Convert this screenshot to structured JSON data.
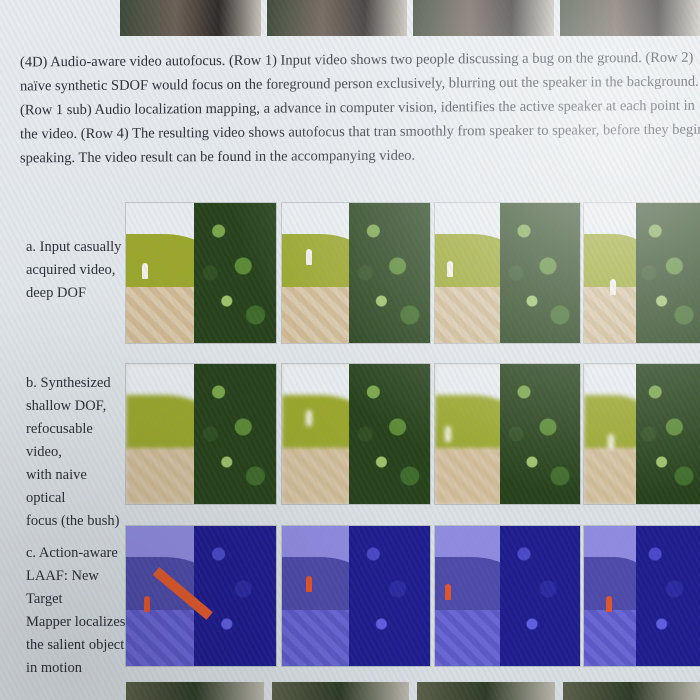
{
  "caption": "(4D) Audio-aware video autofocus. (Row 1) Input video shows two people discussing a bug on the ground. (Row 2) naïve synthetic SDOF would focus on the foreground person exclusively, blurring out the speaker in the background. (Row 1 sub) Audio localization mapping, a advance in computer vision, identifies the active speaker at each point in the video. (Row 4) The resulting video shows autofocus that tran smoothly from speaker to speaker, before they begin speaking. The video result can be found in the accompanying video.",
  "rows": [
    {
      "label": "a. Input casually\nacquired video,\ndeep DOF",
      "style": "normal"
    },
    {
      "label": "b. Synthesized\nshallow DOF,\nrefocusable video,\nwith naive optical\nfocus (the bush)",
      "style": "blur"
    },
    {
      "label": "c. Action-aware\nLAAF: New Target\nMapper localizes\nthe salient object\nin motion",
      "style": "blue"
    }
  ],
  "colors": {
    "background": "#dfe3e6",
    "text": "#2b2f36",
    "grass": "#9aa72c",
    "bush": "#27421b",
    "blue_overlay": "#3a35b5",
    "target_highlight": "#e2552a"
  }
}
